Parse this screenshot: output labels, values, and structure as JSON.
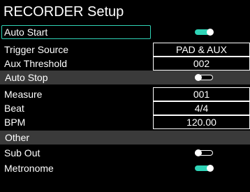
{
  "screen": {
    "title": "RECORDER Setup"
  },
  "colors": {
    "accent": "#2fd3b6",
    "section_bg": "#3a3a3a",
    "background": "#000000"
  },
  "auto_start": {
    "label": "Auto Start",
    "toggle": "on"
  },
  "trigger_source": {
    "label": "Trigger Source",
    "value": "PAD & AUX"
  },
  "aux_threshold": {
    "label": "Aux Threshold",
    "value": "002"
  },
  "auto_stop": {
    "label": "Auto Stop",
    "toggle": "off"
  },
  "measure": {
    "label": "Measure",
    "value": "001"
  },
  "beat": {
    "label": "Beat",
    "value": "4/4"
  },
  "bpm": {
    "label": "BPM",
    "value": "120.00"
  },
  "other": {
    "label": "Other"
  },
  "sub_out": {
    "label": "Sub Out",
    "toggle": "off"
  },
  "metronome": {
    "label": "Metronome",
    "toggle": "on"
  }
}
